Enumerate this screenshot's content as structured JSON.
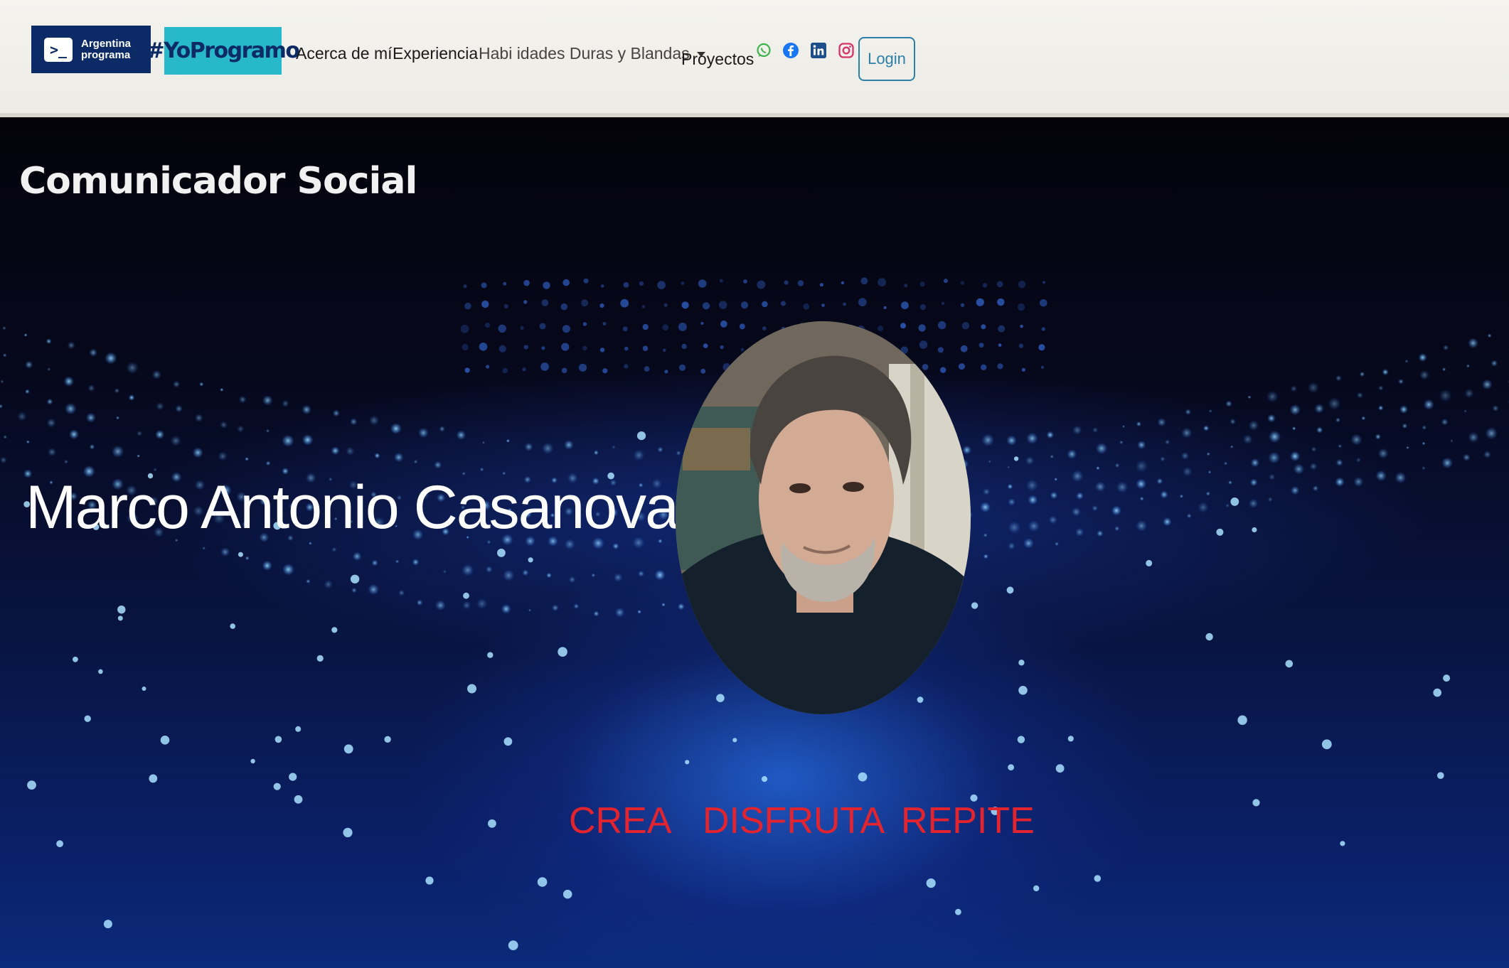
{
  "brand": {
    "ap_line1": "Argentina",
    "ap_line2": "programa",
    "ap_symbol": ">_",
    "yoprogramo": "#YoProgramo"
  },
  "nav": {
    "links": [
      {
        "label": "Acerca de mí"
      },
      {
        "label": "Experiencia"
      },
      {
        "label": "Habi idades Duras y Blandas"
      },
      {
        "label": "Proyectos"
      }
    ],
    "social_icons": [
      "whatsapp-icon",
      "facebook-icon",
      "linkedin-icon",
      "instagram-icon"
    ],
    "login_label": "Login"
  },
  "hero": {
    "subtitle": "Comunicador Social",
    "name": "Marco Antonio Casanova",
    "motto": [
      "CREA",
      "DISFRUTA",
      "REPITE"
    ]
  },
  "colors": {
    "navbar_bg": "#f0efe9",
    "ap_blue": "#0c2a66",
    "yoprogramo_teal": "#27b8c9",
    "login_border": "#2e7ea6",
    "motto_red": "#e3242e",
    "hero_dark": "#05030d",
    "hero_blue": "#0b2a7a"
  }
}
